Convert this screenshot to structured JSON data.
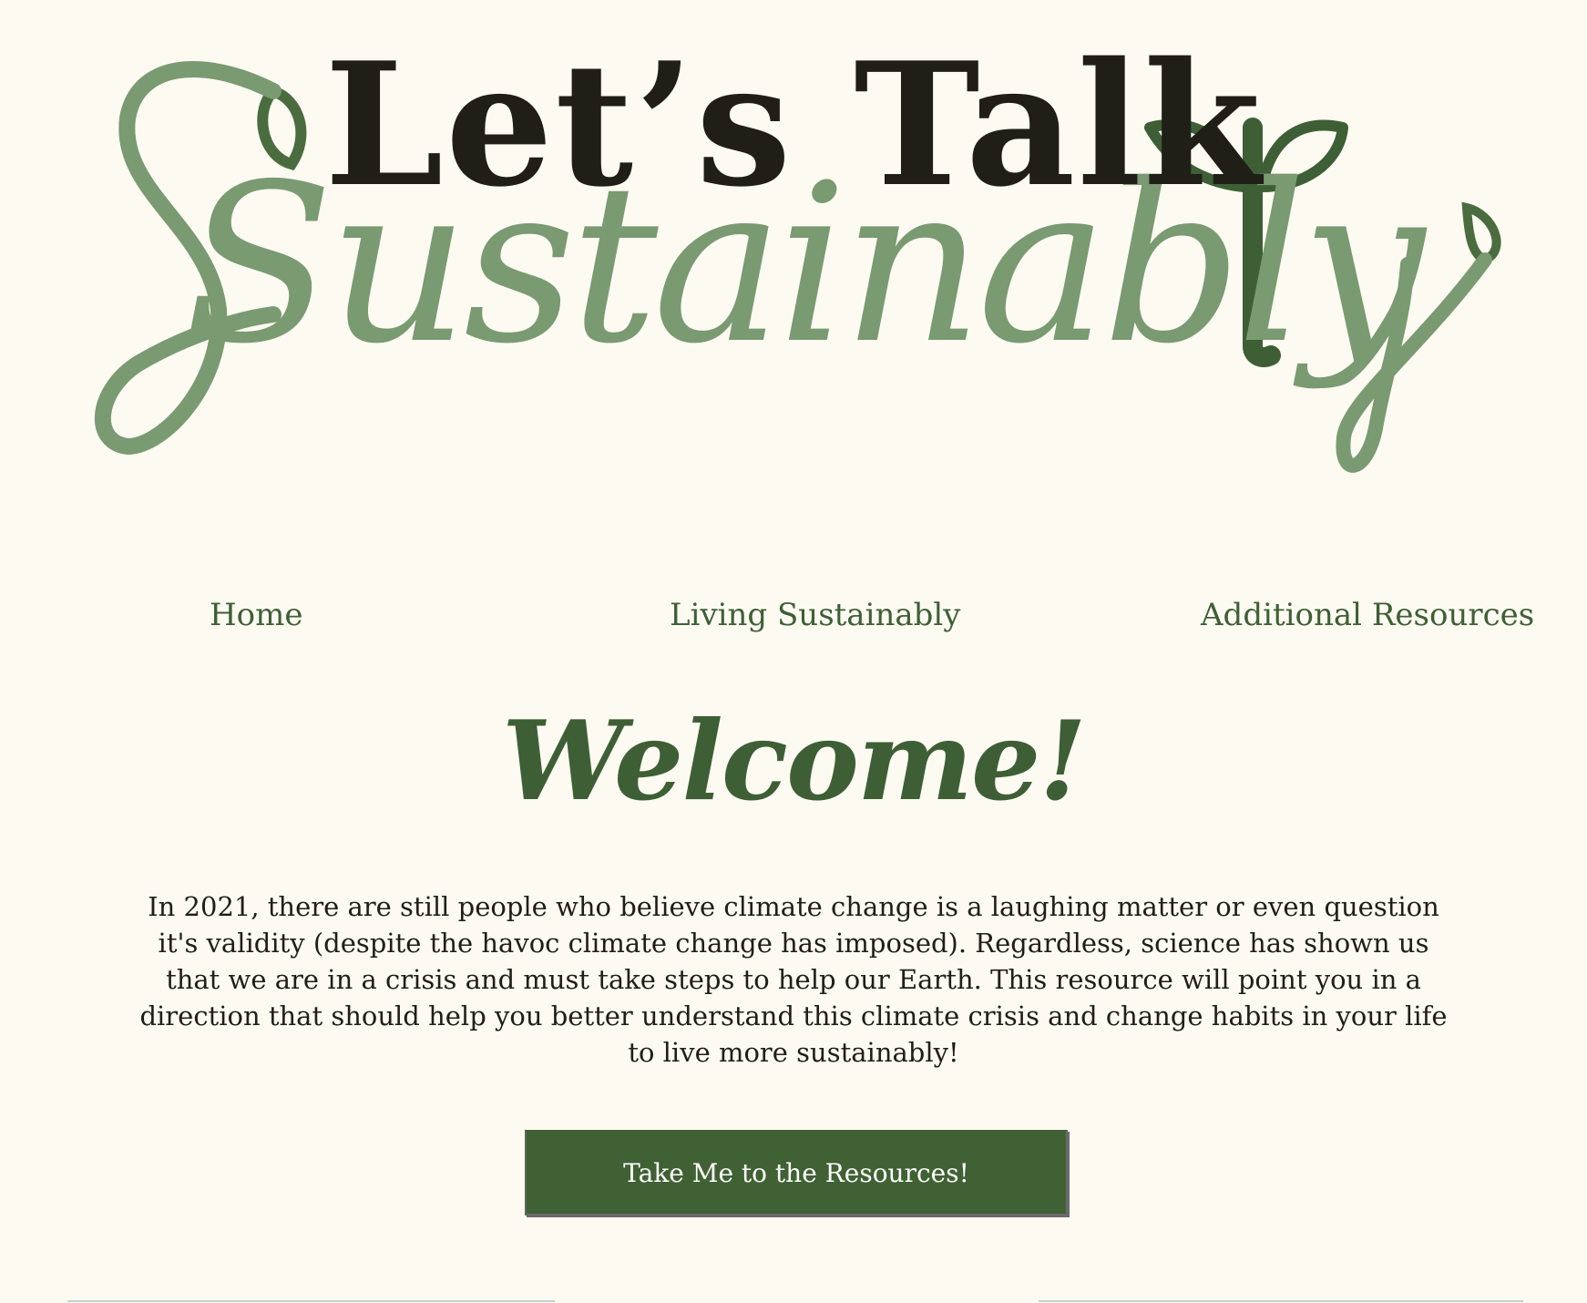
{
  "logo": {
    "title": "Let’s Talk",
    "script": "Sustainably"
  },
  "nav": {
    "items": [
      {
        "label": "Home"
      },
      {
        "label": "Living Sustainably"
      },
      {
        "label": "Additional Resources"
      }
    ]
  },
  "main": {
    "heading": "Welcome!",
    "intro": "In 2021, there are still people who believe climate change is a laughing matter or even question it's validity (despite the havoc climate change has imposed). Regardless, science has shown us that we are in a crisis and must take steps to help our Earth. This resource will point you in a direction that should help you better understand this climate crisis and change habits in your life to live more sustainably!",
    "cta_label": "Take Me to the Resources!"
  },
  "colors": {
    "background": "#fdfaf2",
    "accent_green": "#3e5f35",
    "light_green": "#7a9a72",
    "text_dark": "#1f1f17",
    "button": "#406133"
  }
}
